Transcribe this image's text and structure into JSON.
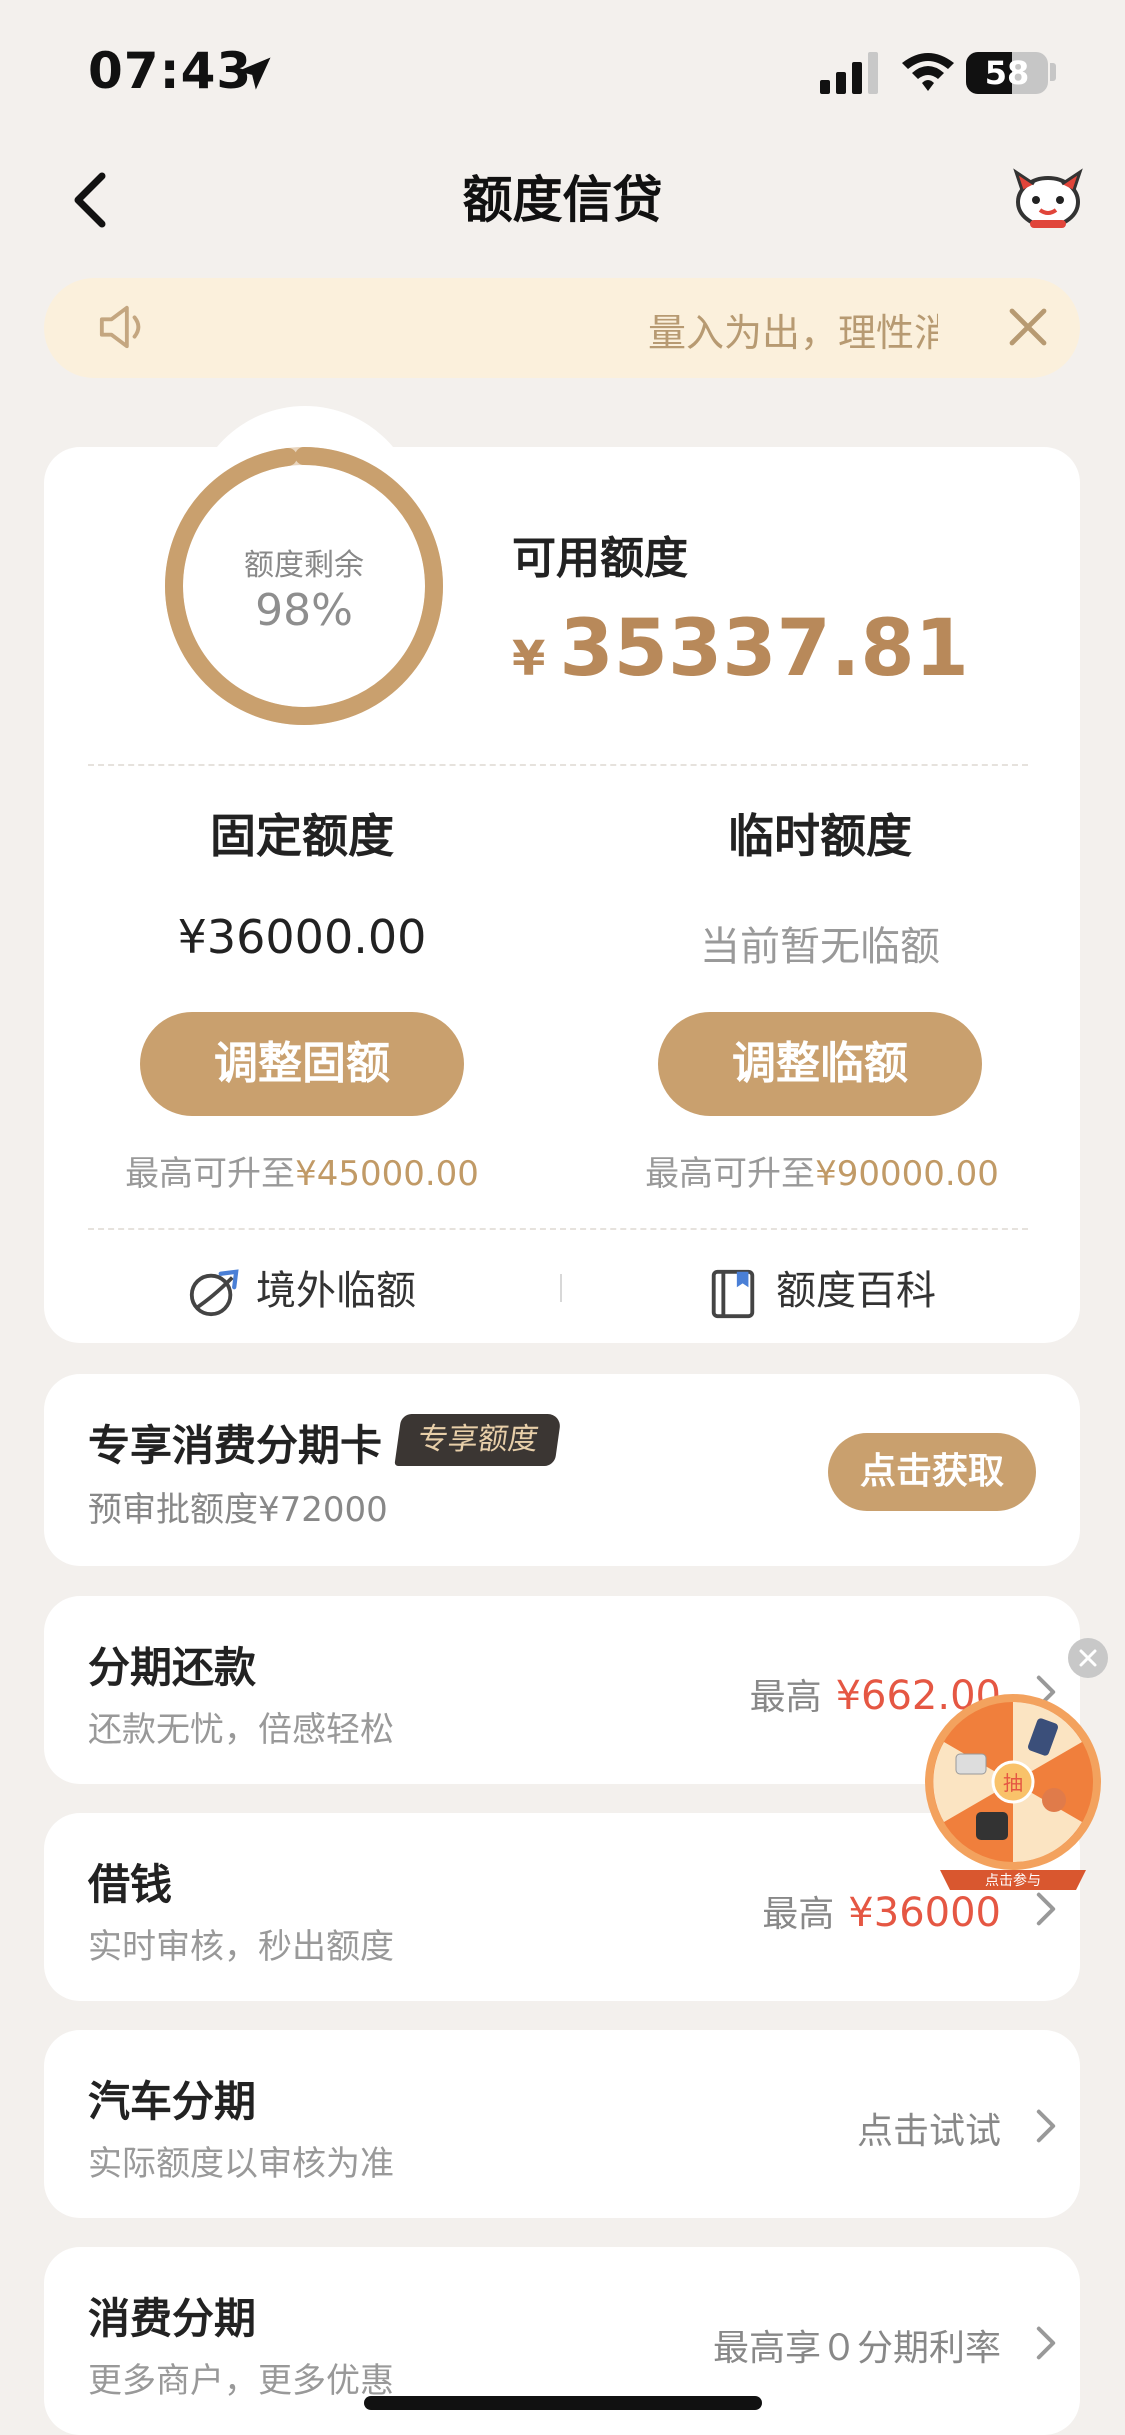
{
  "status_bar": {
    "time": "07:43",
    "battery": "58"
  },
  "nav": {
    "title": "额度信贷"
  },
  "notice": {
    "text": "量入为出，理性消费"
  },
  "credit": {
    "ring_label": "额度剩余",
    "ring_percent_text": "98%",
    "remaining_fraction": 0.98,
    "available_label": "可用额度",
    "currency": "¥",
    "available_amount": "35337.81",
    "fixed": {
      "title": "固定额度",
      "value": "¥36000.00",
      "button": "调整固额",
      "note_prefix": "最高可升至",
      "note_amount": "¥45000.00"
    },
    "temporary": {
      "title": "临时额度",
      "value": "当前暂无临额",
      "button": "调整临额",
      "note_prefix": "最高可升至",
      "note_amount": "¥90000.00"
    },
    "links": [
      {
        "label": "境外临额",
        "icon": "globe-plane-icon"
      },
      {
        "label": "额度百科",
        "icon": "book-icon"
      }
    ]
  },
  "exclusive": {
    "title": "专享消费分期卡",
    "badge": "专享额度",
    "subtitle": "预审批额度¥72000",
    "button": "点击获取"
  },
  "rows": [
    {
      "title": "分期还款",
      "subtitle": "还款无忧，倍感轻松",
      "right_prefix": "最高",
      "right_value": "¥662.00"
    },
    {
      "title": "借钱",
      "subtitle": "实时审核，秒出额度",
      "right_prefix": "最高",
      "right_value": "¥36000"
    },
    {
      "title": "汽车分期",
      "subtitle": "实际额度以审核为准",
      "right_prefix": "点击试试",
      "right_value": ""
    },
    {
      "title": "消费分期",
      "subtitle": "更多商户，更多优惠",
      "right_prefix": "最高享０分期利率",
      "right_value": ""
    }
  ],
  "floating_wheel": {
    "center_label": "抽",
    "caption": "点击参与"
  },
  "colors": {
    "accent": "#c9a06e",
    "amount": "#b8895a",
    "red": "#e55743",
    "background": "#f3f0ed"
  }
}
